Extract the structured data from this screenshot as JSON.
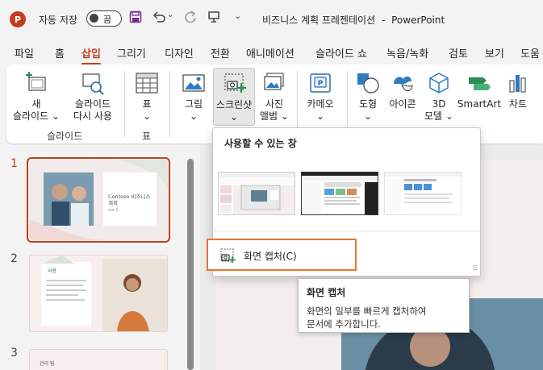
{
  "titlebar": {
    "app_initial": "P",
    "autosave_label": "자동 저장",
    "autosave_state": "끔",
    "document_title": "비즈니스 계획 프레젠테이션",
    "app_name": "PowerPoint",
    "separator": "-"
  },
  "tabs": [
    "파일",
    "홈",
    "삽입",
    "그리기",
    "디자인",
    "전환",
    "애니메이션",
    "슬라이드 쇼",
    "녹음/녹화",
    "검토",
    "보기",
    "도움"
  ],
  "active_tab": "삽입",
  "ribbon": {
    "new_slide_1": "새",
    "new_slide_2": "슬라이드",
    "reuse_slide_1": "슬라이드",
    "reuse_slide_2": "다시 사용",
    "group_slides": "슬라이드",
    "table": "표",
    "group_table": "표",
    "pictures": "그림",
    "screenshot": "스크린샷",
    "photo_album_1": "사진",
    "photo_album_2": "앨범",
    "cameo": "카메오",
    "shapes": "도형",
    "icons": "아이콘",
    "models_1": "3D",
    "models_2": "모델",
    "smartart": "SmartArt",
    "chart": "차트",
    "chevron": "⌄"
  },
  "slides": [
    {
      "number": "1",
      "title": "Contoso 비즈니스 계획",
      "sub": "cm-1"
    },
    {
      "number": "2",
      "title": "사용"
    },
    {
      "number": "3",
      "title": "관리 팀"
    }
  ],
  "dropdown": {
    "heading": "사용할 수 있는 창",
    "screen_capture": "화면 캡처(C)",
    "grip": "⠿"
  },
  "tooltip": {
    "title": "화면 캡처",
    "line1": "화면의 일부를 빠르게 캡처하여",
    "line2": "문서에 추가합니다."
  },
  "colors": {
    "accent": "#c43e1c",
    "highlight_border": "#e8762d"
  }
}
